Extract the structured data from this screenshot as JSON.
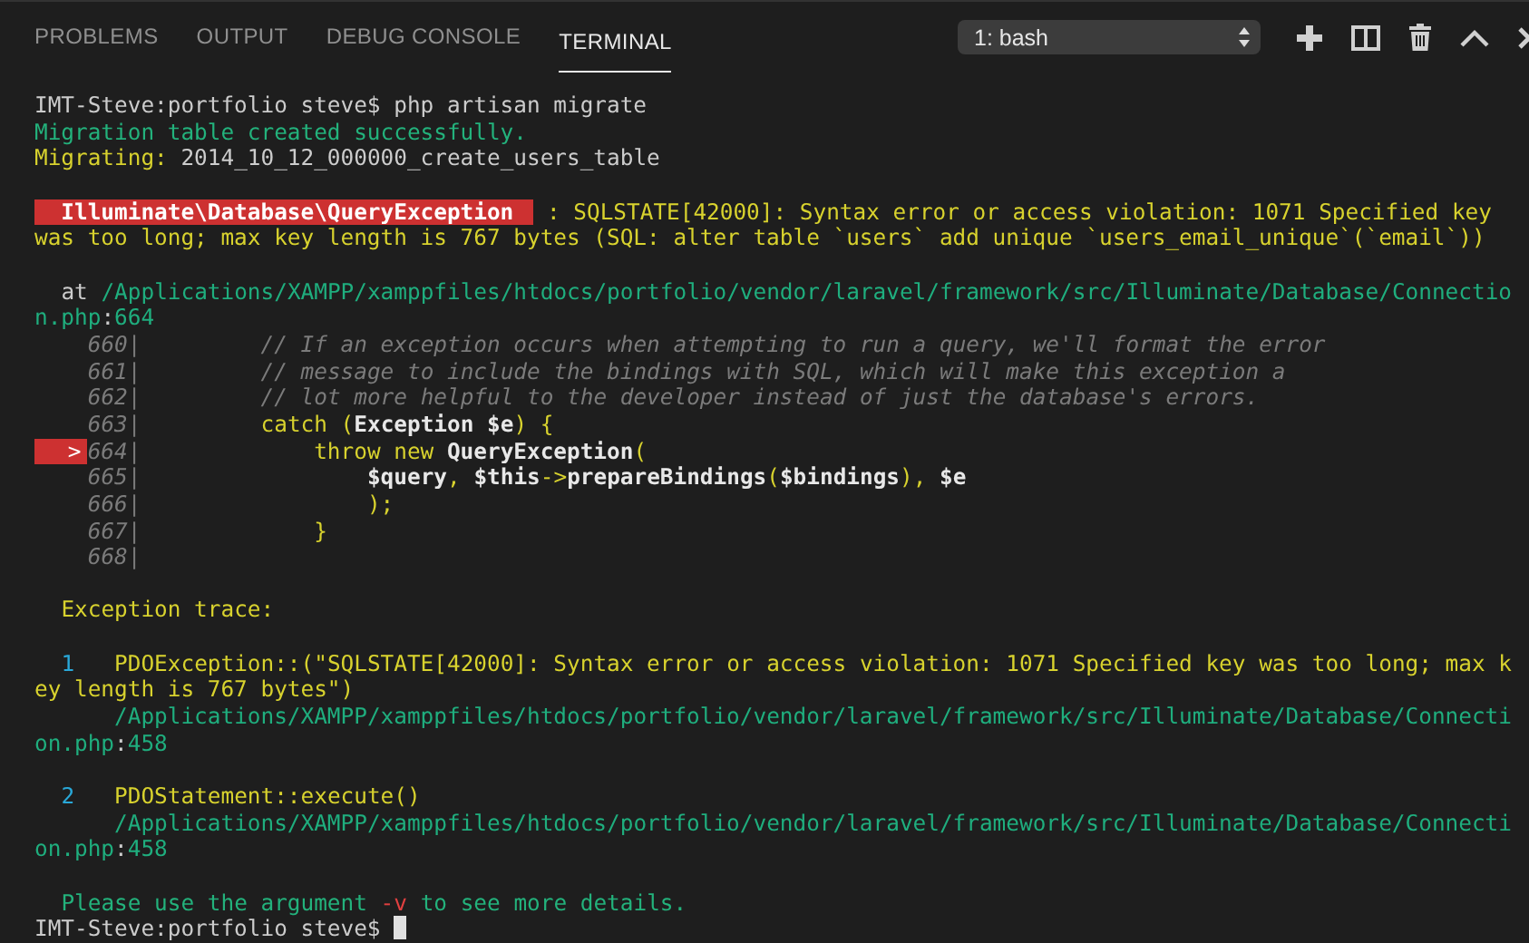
{
  "tabs": [
    {
      "label": "PROBLEMS",
      "selected": false
    },
    {
      "label": "OUTPUT",
      "selected": false
    },
    {
      "label": "DEBUG CONSOLE",
      "selected": false
    },
    {
      "label": "TERMINAL",
      "selected": true
    }
  ],
  "terminal_select": {
    "value": "1: bash"
  },
  "terminal_lines": [
    {
      "spans": [
        {
          "kind": "text",
          "text": "IMT-Steve:portfolio steve$ php artisan migrate"
        }
      ]
    },
    {
      "spans": [
        {
          "kind": "success",
          "text": "Migration table created successfully."
        }
      ]
    },
    {
      "spans": [
        {
          "kind": "warning",
          "text": "Migrating:"
        },
        {
          "kind": "text",
          "text": " 2014_10_12_000000_create_users_table"
        }
      ]
    },
    {
      "blank_before": true,
      "spans": [
        {
          "kind": "badge",
          "text": "  Illuminate\\Database\\QueryException"
        },
        {
          "kind": "warning",
          "text": " : SQLSTATE[42000]: Syntax error or access violation: 1071 Specified key"
        }
      ]
    },
    {
      "spans": [
        {
          "kind": "warning",
          "text": "was too long; max key length is 767 bytes (SQL: alter table `users` add unique `users_email_unique`(`email`))"
        }
      ]
    },
    {
      "blank_before": true,
      "spans": [
        {
          "kind": "text",
          "text": "  at"
        },
        {
          "kind": "path",
          "text": " /Applications/XAMPP/xamppfiles/htdocs/portfolio/vendor/laravel/framework/src/Illuminate/Database/Connectio"
        }
      ]
    },
    {
      "spans": [
        {
          "kind": "path",
          "text": "n.php"
        },
        {
          "kind": "text",
          "text": ":"
        },
        {
          "kind": "path",
          "text": "664"
        }
      ]
    },
    {
      "spans": [
        {
          "kind": "lineno",
          "text": "    660|"
        },
        {
          "kind": "comment",
          "text": "         // If an exception occurs when attempting to run a query, we'll format the error"
        }
      ]
    },
    {
      "spans": [
        {
          "kind": "lineno",
          "text": "    661|"
        },
        {
          "kind": "comment",
          "text": "         // message to include the bindings with SQL, which will make this exception a"
        }
      ]
    },
    {
      "spans": [
        {
          "kind": "lineno",
          "text": "    662|"
        },
        {
          "kind": "comment",
          "text": "         // lot more helpful to the developer instead of just the database's errors."
        }
      ]
    },
    {
      "spans": [
        {
          "kind": "lineno",
          "text": "    663|"
        },
        {
          "kind": "code",
          "text": "         catch ("
        },
        {
          "kind": "strong",
          "text": "Exception $e"
        },
        {
          "kind": "code",
          "text": ") {"
        }
      ]
    },
    {
      "spans": [
        {
          "kind": "marker",
          "text": ">"
        },
        {
          "kind": "lineno",
          "text": "664|"
        },
        {
          "kind": "code",
          "text": "             throw new "
        },
        {
          "kind": "strong",
          "text": "QueryException"
        },
        {
          "kind": "code",
          "text": "("
        }
      ]
    },
    {
      "spans": [
        {
          "kind": "lineno",
          "text": "    665|"
        },
        {
          "kind": "strong",
          "text": "                 $query"
        },
        {
          "kind": "code",
          "text": ", "
        },
        {
          "kind": "strong",
          "text": "$this"
        },
        {
          "kind": "code",
          "text": "->"
        },
        {
          "kind": "strong",
          "text": "prepareBindings"
        },
        {
          "kind": "code",
          "text": "("
        },
        {
          "kind": "strong",
          "text": "$bindings"
        },
        {
          "kind": "code",
          "text": "), "
        },
        {
          "kind": "strong",
          "text": "$e"
        }
      ]
    },
    {
      "spans": [
        {
          "kind": "lineno",
          "text": "    666|"
        },
        {
          "kind": "code",
          "text": "                 );"
        }
      ]
    },
    {
      "spans": [
        {
          "kind": "lineno",
          "text": "    667|"
        },
        {
          "kind": "code",
          "text": "             }"
        }
      ]
    },
    {
      "spans": [
        {
          "kind": "lineno",
          "text": "    668|"
        }
      ]
    },
    {
      "blank_before": true,
      "spans": [
        {
          "kind": "warning",
          "text": "  Exception trace:"
        }
      ]
    },
    {
      "blank_before": true,
      "spans": [
        {
          "kind": "index",
          "text": "  1"
        },
        {
          "kind": "warning",
          "text": "   PDOException::(\"SQLSTATE[42000]: Syntax error or access violation: 1071 Specified key was too long; max k"
        }
      ]
    },
    {
      "spans": [
        {
          "kind": "warning",
          "text": "ey length is 767 bytes\")"
        }
      ]
    },
    {
      "spans": [
        {
          "kind": "path",
          "text": "      /Applications/XAMPP/xamppfiles/htdocs/portfolio/vendor/laravel/framework/src/Illuminate/Database/Connecti"
        }
      ]
    },
    {
      "spans": [
        {
          "kind": "path",
          "text": "on.php"
        },
        {
          "kind": "text",
          "text": ":"
        },
        {
          "kind": "path",
          "text": "458"
        }
      ]
    },
    {
      "blank_before": true,
      "spans": [
        {
          "kind": "index",
          "text": "  2"
        },
        {
          "kind": "warning",
          "text": "   PDOStatement::execute()"
        }
      ]
    },
    {
      "spans": [
        {
          "kind": "path",
          "text": "      /Applications/XAMPP/xamppfiles/htdocs/portfolio/vendor/laravel/framework/src/Illuminate/Database/Connecti"
        }
      ]
    },
    {
      "spans": [
        {
          "kind": "path",
          "text": "on.php"
        },
        {
          "kind": "text",
          "text": ":"
        },
        {
          "kind": "path",
          "text": "458"
        }
      ]
    },
    {
      "blank_before": true,
      "spans": [
        {
          "kind": "success",
          "text": "  Please use the argument "
        },
        {
          "kind": "flag",
          "text": "-v"
        },
        {
          "kind": "success",
          "text": " to see more details."
        }
      ]
    },
    {
      "spans": [
        {
          "kind": "text",
          "text": "IMT-Steve:portfolio steve$ "
        },
        {
          "kind": "cursor"
        }
      ]
    }
  ]
}
